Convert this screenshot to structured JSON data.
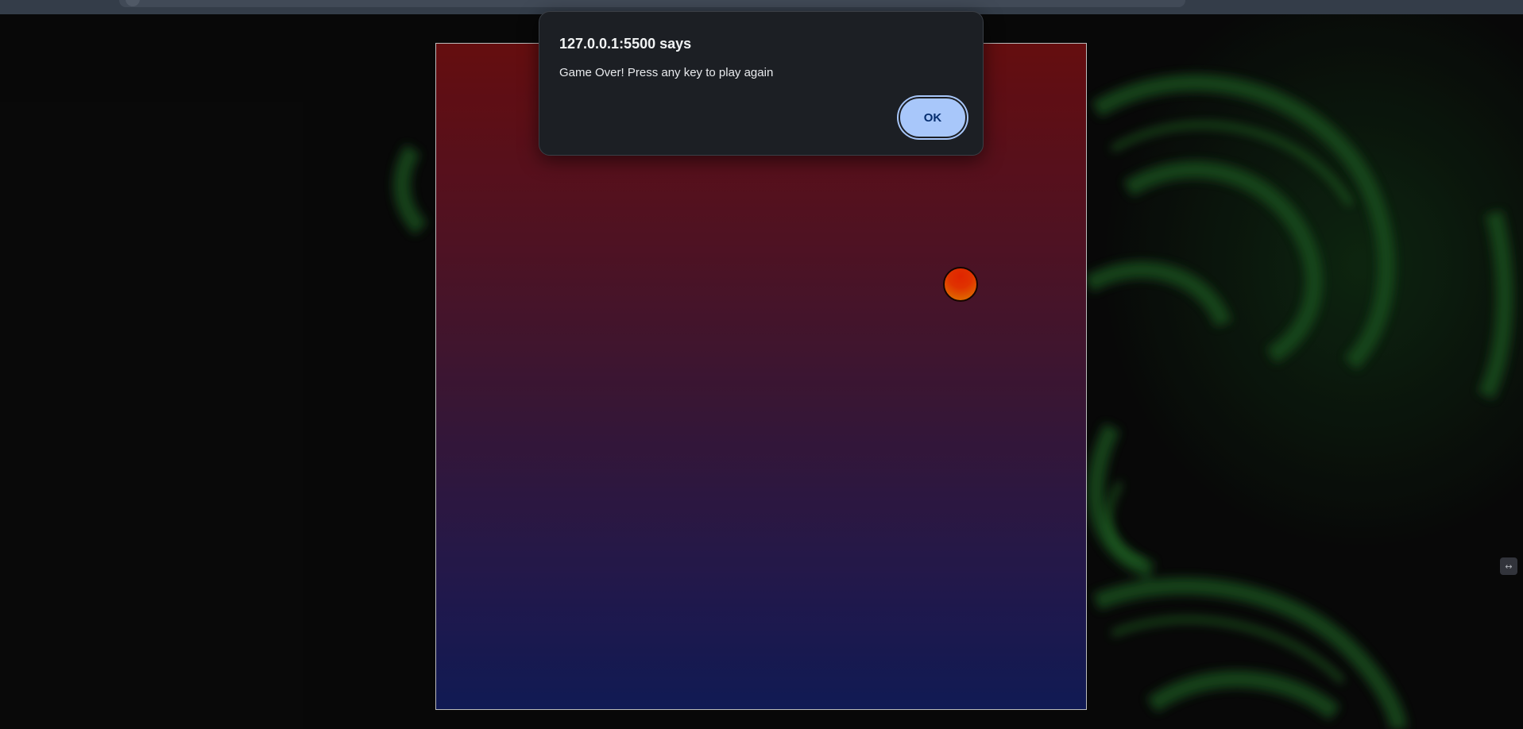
{
  "dialog": {
    "title": "127.0.0.1:5500 says",
    "message": "Game Over! Press any key to play again",
    "ok_label": "OK"
  },
  "game": {
    "background_top_color": "#731012",
    "background_bottom_color": "#131e60",
    "ball_color": "#ff3a00"
  },
  "side_widget": {
    "icon": "collapse-icon"
  }
}
